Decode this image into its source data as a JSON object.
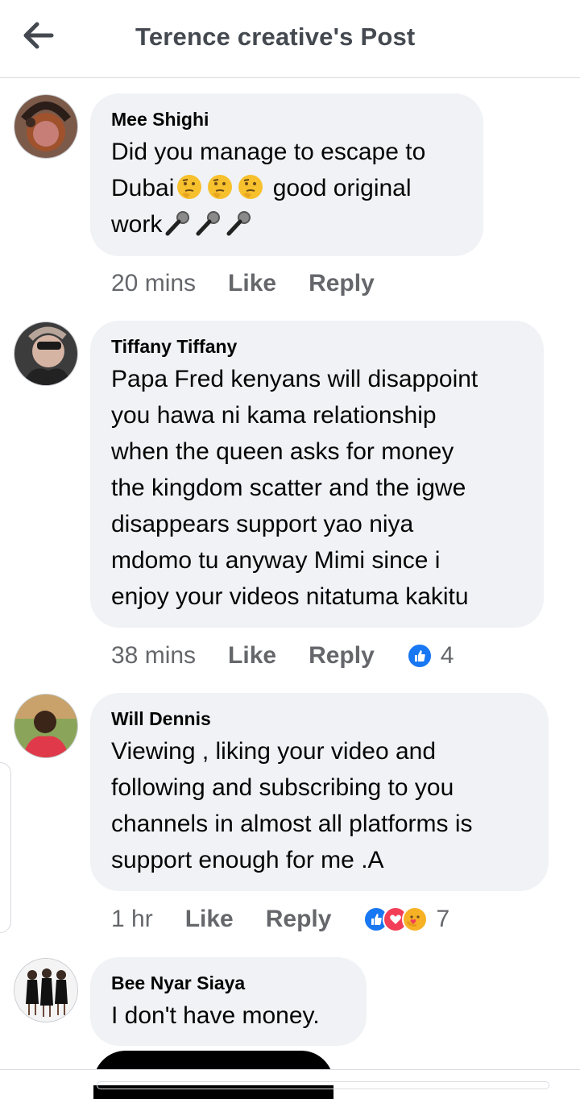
{
  "header": {
    "title": "Terence creative's Post",
    "back_icon": "back-arrow-icon"
  },
  "comments": [
    {
      "author": "Mee Shighi",
      "line1": "Did you manage to escape to",
      "line2_pre": "Dubai",
      "line2_post": " good original",
      "line3_pre": "work",
      "emojis": [
        "thinking-face-emoji",
        "microphone-emoji"
      ],
      "time": "20 mins",
      "like": "Like",
      "reply": "Reply"
    },
    {
      "author": "Tiffany Tiffany",
      "lines": [
        "Papa Fred kenyans will disappoint",
        "you hawa ni kama relationship",
        "when  the queen asks for money",
        "the kingdom scatter and the igwe",
        "disappears support yao niya",
        "mdomo tu anyway Mimi since i",
        "enjoy your videos nitatuma kakitu"
      ],
      "time": "38 mins",
      "like": "Like",
      "reply": "Reply",
      "reaction_count": "4",
      "reaction_icons": [
        "like-reaction-icon"
      ]
    },
    {
      "author": "Will Dennis",
      "lines": [
        "Viewing , liking your video and",
        "following and subscribing to you",
        "channels in almost all platforms is",
        "support enough for me .A"
      ],
      "time": "1 hr",
      "like": "Like",
      "reply": "Reply",
      "reaction_count": "7",
      "reaction_icons": [
        "like-reaction-icon",
        "love-reaction-icon",
        "care-reaction-icon"
      ]
    },
    {
      "author": "Bee Nyar Siaya",
      "lines": [
        "I don't have money."
      ]
    }
  ],
  "colors": {
    "bubble": "#f0f2f5",
    "meta_text": "#65676b",
    "like_blue": "#1877f2",
    "love_red": "#f33e58",
    "care_yellow": "#f7b125"
  }
}
